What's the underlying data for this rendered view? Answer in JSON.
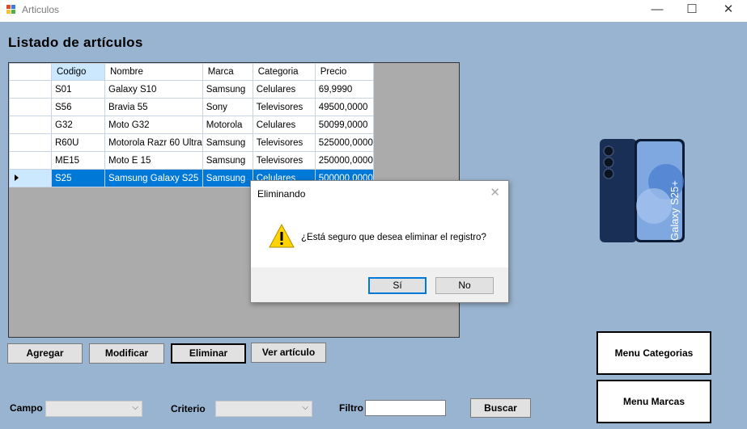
{
  "window": {
    "title": "Articulos",
    "minimize_icon": "minimize-icon",
    "maximize_icon": "maximize-icon",
    "close_icon": "close-icon"
  },
  "page_title": "Listado de artículos",
  "grid": {
    "columns": [
      "Codigo",
      "Nombre",
      "Marca",
      "Categoria",
      "Precio"
    ],
    "rows": [
      {
        "codigo": "S01",
        "nombre": "Galaxy S10",
        "marca": "Samsung",
        "categoria": "Celulares",
        "precio": "69,9990"
      },
      {
        "codigo": "S56",
        "nombre": "Bravia 55",
        "marca": "Sony",
        "categoria": "Televisores",
        "precio": "49500,0000"
      },
      {
        "codigo": "G32",
        "nombre": "Moto G32",
        "marca": "Motorola",
        "categoria": "Celulares",
        "precio": "50099,0000"
      },
      {
        "codigo": "R60U",
        "nombre": "Motorola Razr 60 Ultra",
        "marca": "Samsung",
        "categoria": "Televisores",
        "precio": "525000,0000"
      },
      {
        "codigo": "ME15",
        "nombre": "Moto E 15",
        "marca": "Samsung",
        "categoria": "Televisores",
        "precio": "250000,0000"
      },
      {
        "codigo": "S25",
        "nombre": "Samsung Galaxy S25",
        "marca": "Samsung",
        "categoria": "Celulares",
        "precio": "500000,0000"
      }
    ],
    "selected_row": 5
  },
  "buttons": {
    "agregar": "Agregar",
    "modificar": "Modificar",
    "eliminar": "Eliminar",
    "ver": "Ver artículo",
    "menu_categorias": "Menu Categorias",
    "menu_marcas": "Menu Marcas",
    "buscar": "Buscar"
  },
  "filter": {
    "campo_label": "Campo",
    "criterio_label": "Criterio",
    "filtro_label": "Filtro",
    "campo_value": "",
    "criterio_value": "",
    "filtro_value": ""
  },
  "product_image": {
    "text": "Galaxy S25+",
    "body_color": "#1a2f55",
    "screen_color": "#7fa8e0"
  },
  "dialog": {
    "title": "Eliminando",
    "message": "¿Está seguro que desea eliminar el registro?",
    "icon": "warning-icon",
    "yes": "Sí",
    "no": "No"
  }
}
